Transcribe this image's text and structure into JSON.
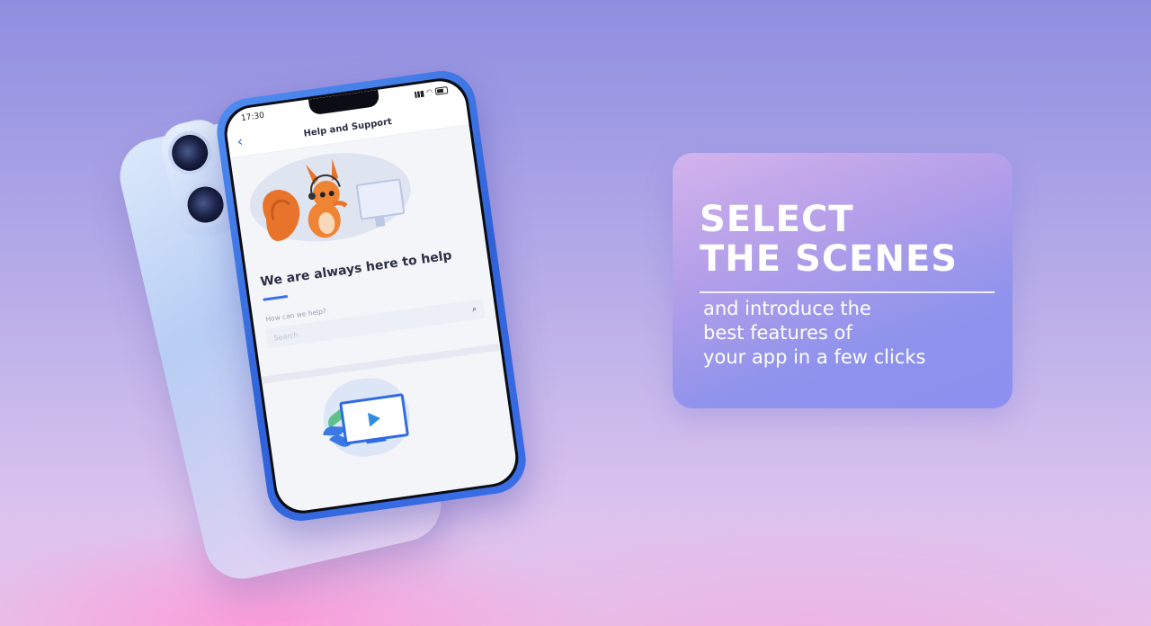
{
  "phone": {
    "status_time": "17:30",
    "header_title": "Help and Support",
    "help_title": "We are always here to help",
    "search_label": "How can we help?",
    "search_placeholder": "Search"
  },
  "promo": {
    "headline_line1": "SELECT",
    "headline_line2": "THE SCENES",
    "sub_line1": "and introduce the",
    "sub_line2": "best features of",
    "sub_line3": "your app in a few clicks"
  },
  "icons": {
    "back": "chevron-left-icon",
    "search": "search-icon",
    "play": "play-icon",
    "signal": "signal-icon",
    "wifi": "wifi-icon",
    "battery": "battery-icon"
  },
  "colors": {
    "accent": "#3b6fe6",
    "card_gradient_start": "#d3b3ec",
    "card_gradient_end": "#8d8ff0"
  }
}
